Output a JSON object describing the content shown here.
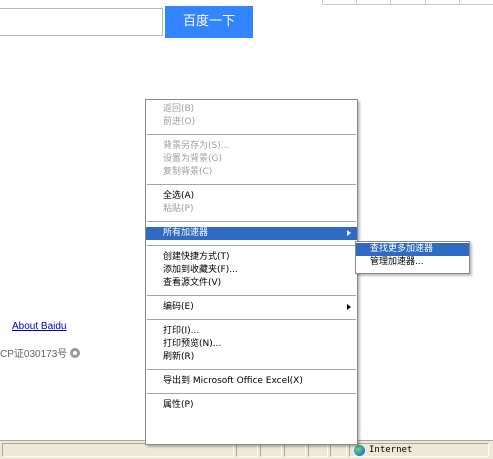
{
  "search": {
    "button_label": "百度一下"
  },
  "footer": {
    "about_link": "About Baidu",
    "icp_text": "CP证030173号"
  },
  "status_bar": {
    "zone_label": "Internet"
  },
  "context_menu": {
    "back": "返回(B)",
    "forward": "前进(O)",
    "save_background_as": "背景另存为(S)...",
    "set_as_background": "设置为背景(G)",
    "copy_background": "复制背景(C)",
    "select_all": "全选(A)",
    "paste": "粘贴(P)",
    "all_accelerators": "所有加速器",
    "create_shortcut": "创建快捷方式(T)",
    "add_to_favorites": "添加到收藏夹(F)...",
    "view_source": "查看源文件(V)",
    "encoding": "编码(E)",
    "print": "打印(I)...",
    "print_preview": "打印预览(N)...",
    "refresh": "刷新(R)",
    "export_excel": "导出到 Microsoft Office Excel(X)",
    "properties": "属性(P)"
  },
  "submenu": {
    "find_more": "查找更多加速器",
    "manage": "管理加速器..."
  }
}
